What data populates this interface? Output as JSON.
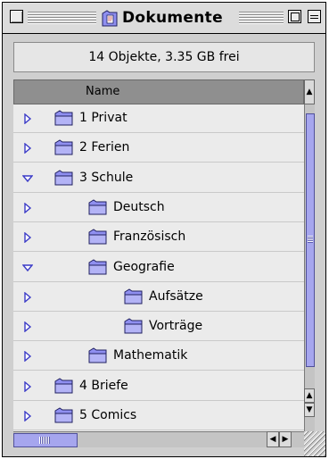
{
  "window": {
    "title": "Dokumente",
    "info": "14 Objekte, 3.35 GB frei",
    "column_header": "Name"
  },
  "rows": [
    {
      "label": "1 Privat",
      "expanded": false,
      "level": 0
    },
    {
      "label": "2 Ferien",
      "expanded": false,
      "level": 0
    },
    {
      "label": "3 Schule",
      "expanded": true,
      "level": 0
    },
    {
      "label": "Deutsch",
      "expanded": false,
      "level": 1
    },
    {
      "label": "Französisch",
      "expanded": false,
      "level": 1
    },
    {
      "label": "Geografie",
      "expanded": true,
      "level": 1
    },
    {
      "label": "Aufsätze",
      "expanded": false,
      "level": 2
    },
    {
      "label": "Vorträge",
      "expanded": false,
      "level": 2
    },
    {
      "label": "Mathematik",
      "expanded": false,
      "level": 1
    },
    {
      "label": "4 Briefe",
      "expanded": false,
      "level": 0
    },
    {
      "label": "5 Comics",
      "expanded": false,
      "level": 0
    }
  ],
  "colors": {
    "folder": "#8f8ff0",
    "scroll_thumb": "#a6a6ee",
    "triangle": "#3b3bc7"
  },
  "icons": {
    "collapsed": "triangle-right-icon",
    "expanded": "triangle-down-icon",
    "folder": "folder-icon"
  }
}
